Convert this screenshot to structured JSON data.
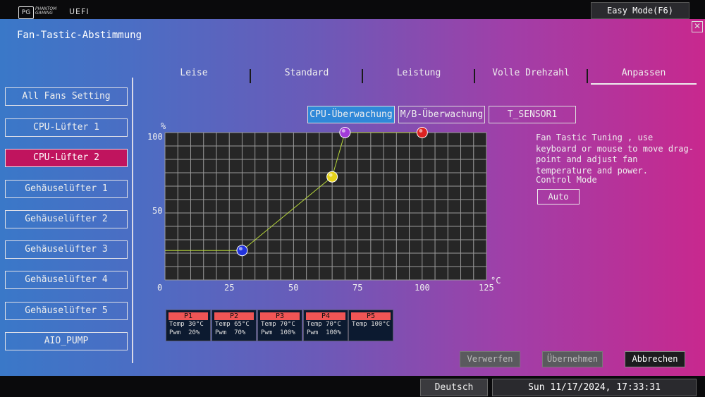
{
  "topbar": {
    "logo_text": "PG",
    "brand_line1": "PHANTOM",
    "brand_line2": "GAMING",
    "uefi_label": "UEFI",
    "easy_mode_label": "Easy Mode(F6)"
  },
  "page": {
    "title": "Fan-Tastic-Abstimmung"
  },
  "fans": [
    {
      "label": "All Fans Setting"
    },
    {
      "label": "CPU-Lüfter 1"
    },
    {
      "label": "CPU-Lüfter 2"
    },
    {
      "label": "Gehäuselüfter 1"
    },
    {
      "label": "Gehäuselüfter 2"
    },
    {
      "label": "Gehäuselüfter 3"
    },
    {
      "label": "Gehäuselüfter 4"
    },
    {
      "label": "Gehäuselüfter 5"
    },
    {
      "label": "AIO_PUMP"
    }
  ],
  "tabs": [
    {
      "label": "Leise"
    },
    {
      "label": "Standard"
    },
    {
      "label": "Leistung"
    },
    {
      "label": "Volle Drehzahl"
    },
    {
      "label": "Anpassen"
    }
  ],
  "sources": [
    {
      "label": "CPU-Überwachung"
    },
    {
      "label": "M/B-Überwachung"
    },
    {
      "label": "T_SENSOR1"
    }
  ],
  "chart_data": {
    "type": "line",
    "ylabel": "%",
    "xlabel": "°C",
    "xlim": [
      0,
      125
    ],
    "ylim": [
      0,
      100
    ],
    "x_ticks": [
      "0",
      "25",
      "50",
      "75",
      "100",
      "125"
    ],
    "y_ticks": [
      "100",
      "50"
    ],
    "grid": true,
    "points": [
      {
        "name": "P1",
        "temp": 30,
        "pwm": 20,
        "color": "#2233dd"
      },
      {
        "name": "P2",
        "temp": 65,
        "pwm": 70,
        "color": "#e6d21a"
      },
      {
        "name": "P3",
        "temp": 70,
        "pwm": 100,
        "color": "#a23ad8"
      },
      {
        "name": "P5",
        "temp": 100,
        "pwm": 100,
        "color": "#dd2222"
      }
    ]
  },
  "help": {
    "text": "Fan Tastic Tuning , use keyboard or mouse to move drag-point and adjust fan temperature and power.",
    "control_mode_label": "Control Mode",
    "control_mode_value": "Auto"
  },
  "points_table": [
    {
      "name": "P1",
      "temp": "Temp 30°C",
      "pwm": "Pwm  20%"
    },
    {
      "name": "P2",
      "temp": "Temp 65°C",
      "pwm": "Pwm  70%"
    },
    {
      "name": "P3",
      "temp": "Temp 70°C",
      "pwm": "Pwm  100%"
    },
    {
      "name": "P4",
      "temp": "Temp 70°C",
      "pwm": "Pwm  100%"
    },
    {
      "name": "P5",
      "temp": "Temp 100°C",
      "pwm": ""
    }
  ],
  "actions": {
    "discard": "Verwerfen",
    "apply": "Übernehmen",
    "cancel": "Abbrechen"
  },
  "bottombar": {
    "language": "Deutsch",
    "datetime": "Sun 11/17/2024, 17:33:31"
  }
}
